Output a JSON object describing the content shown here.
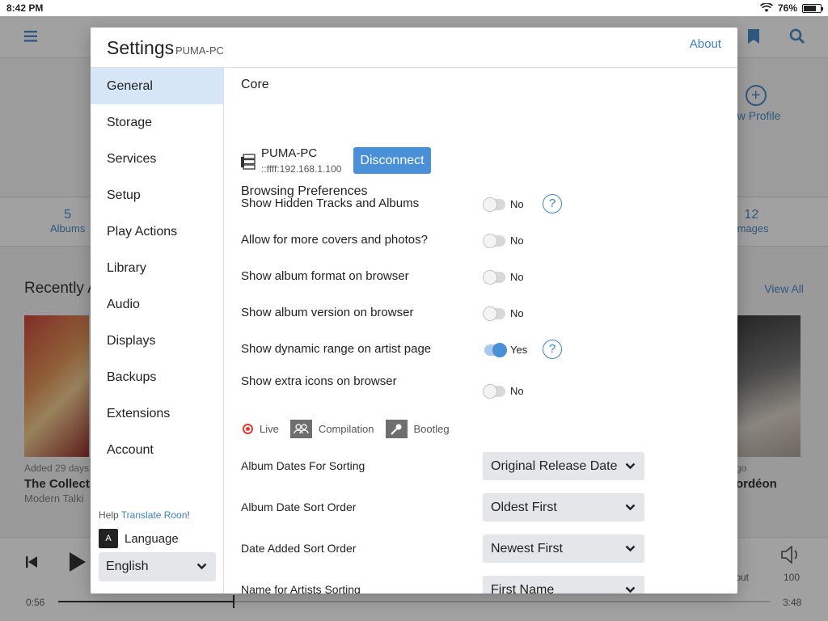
{
  "status": {
    "time": "8:42 PM",
    "battery": "76%",
    "battery_fraction": 0.76
  },
  "background": {
    "add_profile": "ew Profile",
    "stats": [
      {
        "num": "5",
        "label": "Albums"
      },
      {
        "num": "12",
        "label": "Images"
      }
    ],
    "recent_title": "Recently A",
    "view_all": "View All",
    "left_album": {
      "meta": "Added 29 days",
      "name": "The Collecti",
      "artist": "Modern Talki"
    },
    "right_album": {
      "meta": "go",
      "name": "ordéon"
    },
    "player": {
      "elapsed": "0:56",
      "total": "3:48",
      "volume": "100",
      "output": "tput",
      "progress_fraction": 0.246
    }
  },
  "modal": {
    "title": "Settings",
    "subtitle": "PUMA-PC",
    "about": "About",
    "nav": [
      "General",
      "Storage",
      "Services",
      "Setup",
      "Play Actions",
      "Library",
      "Audio",
      "Displays",
      "Backups",
      "Extensions",
      "Account"
    ],
    "active_nav": "General",
    "help_text": "Help ",
    "help_link": "Translate Roon",
    "help_suffix": "!",
    "language_label": "Language",
    "language_icon": "A",
    "language_value": "English",
    "core": {
      "heading": "Core",
      "name": "PUMA-PC",
      "ip": "::ffff:192.168.1.100",
      "button": "Disconnect"
    },
    "browsing_heading": "Browsing Preferences",
    "toggles": [
      {
        "label": "Show Hidden Tracks and Albums",
        "on": false,
        "value": "No",
        "help": true
      },
      {
        "label": "Allow for more covers and photos?",
        "on": false,
        "value": "No",
        "help": false
      },
      {
        "label": "Show album format on browser",
        "on": false,
        "value": "No",
        "help": false
      },
      {
        "label": "Show album version on browser",
        "on": false,
        "value": "No",
        "help": false
      },
      {
        "label": "Show dynamic range on artist page",
        "on": true,
        "value": "Yes",
        "help": true
      },
      {
        "label": "Show extra icons on browser",
        "on": false,
        "value": "No",
        "help": false
      }
    ],
    "help_symbol": "?",
    "extra_icons": [
      {
        "label": "Live",
        "icon": "live-dot-icon"
      },
      {
        "label": "Compilation",
        "icon": "compilation-icon"
      },
      {
        "label": "Bootleg",
        "icon": "microphone-icon"
      }
    ],
    "dropdowns": [
      {
        "label": "Album Dates For Sorting",
        "value": "Original Release Date"
      },
      {
        "label": "Album Date Sort Order",
        "value": "Oldest First"
      },
      {
        "label": "Date Added Sort Order",
        "value": "Newest First"
      },
      {
        "label": "Name for Artists Sorting",
        "value": "First Name"
      }
    ]
  }
}
